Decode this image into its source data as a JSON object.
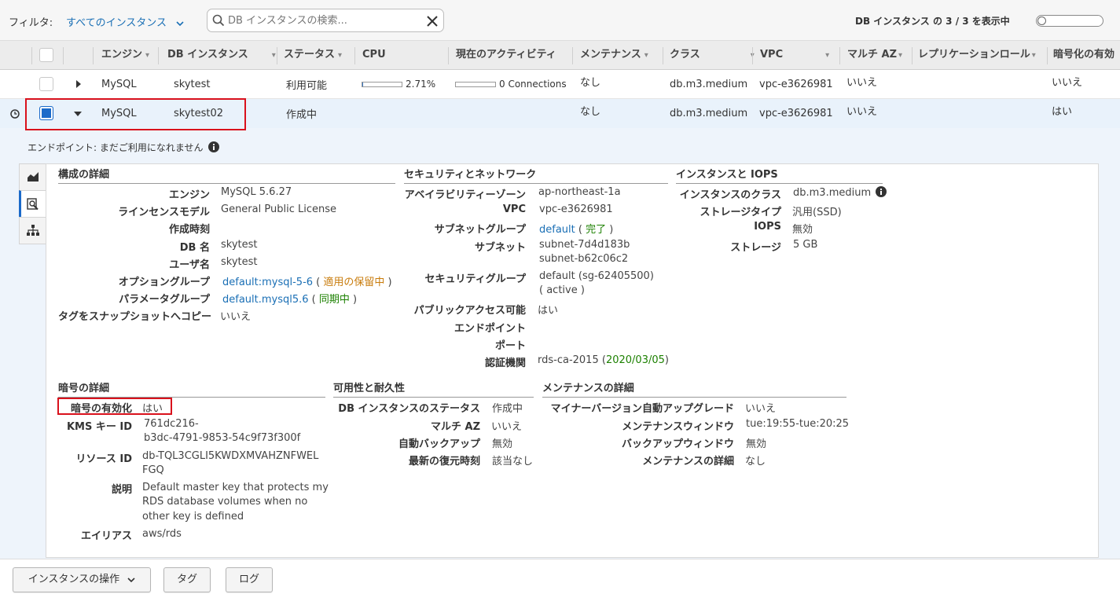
{
  "filter": {
    "label": "フィルタ:",
    "selected": "すべてのインスタンス",
    "search_placeholder": "DB インスタンスの検索...",
    "count_text": "DB インスタンス の 3 / 3 を表示中"
  },
  "table": {
    "headers": {
      "engine": "エンジン",
      "db_instance": "DB インスタンス",
      "status": "ステータス",
      "cpu": "CPU",
      "activity": "現在のアクティビティ",
      "maintenance": "メンテナンス",
      "class": "クラス",
      "vpc": "VPC",
      "multi_az": "マルチ AZ",
      "replication": "レプリケーションロール",
      "encryption": "暗号化の有効"
    },
    "rows": [
      {
        "engine": "MySQL",
        "instance": "skytest",
        "status": "利用可能",
        "cpu_text": "2.71%",
        "cpu_percent": 2.71,
        "activity": "0 Connections",
        "maintenance": "なし",
        "class": "db.m3.medium",
        "vpc": "vpc-e3626981",
        "multi_az": "いいえ",
        "encryption": "いいえ"
      },
      {
        "engine": "MySQL",
        "instance": "skytest02",
        "status": "作成中",
        "maintenance": "なし",
        "class": "db.m3.medium",
        "vpc": "vpc-e3626981",
        "multi_az": "いいえ",
        "encryption": "はい"
      }
    ]
  },
  "detail": {
    "endpoint_note": "エンドポイント: まだご利用になれません",
    "config": {
      "title": "構成の詳細",
      "engine_l": "エンジン",
      "engine_v": "MySQL 5.6.27",
      "license_l": "ラインセンスモデル",
      "license_v": "General Public License",
      "created_l": "作成時刻",
      "dbname_l": "DB 名",
      "dbname_v": "skytest",
      "user_l": "ユーザ名",
      "user_v": "skytest",
      "optgroup_l": "オプショングループ",
      "optgroup_link": "default:mysql-5-6",
      "optgroup_status": "適用の保留中",
      "paramgroup_l": "パラメータグループ",
      "paramgroup_link": "default.mysql5.6",
      "paramgroup_status": "同期中",
      "tagcopy_l": "タグをスナップショットへコピー",
      "tagcopy_v": "いいえ"
    },
    "security": {
      "title": "セキュリティとネットワーク",
      "az_l": "アベイラビリティーゾーン",
      "az_v": "ap-northeast-1a",
      "vpc_l": "VPC",
      "vpc_v": "vpc-e3626981",
      "subnetgroup_l": "サブネットグループ",
      "subnetgroup_link": "default",
      "subnetgroup_status": "完了",
      "subnet_l": "サブネット",
      "subnet_v1": "subnet-7d4d183b",
      "subnet_v2": "subnet-b62c06c2",
      "secgroup_l": "セキュリティグループ",
      "secgroup_v": "default (sg-62405500)",
      "secgroup_state": "( active )",
      "public_l": "パブリックアクセス可能",
      "public_v": "はい",
      "endpoint_l": "エンドポイント",
      "port_l": "ポート",
      "ca_l": "認証機関",
      "ca_v": "rds-ca-2015",
      "ca_date": "2020/03/05"
    },
    "iops": {
      "title": "インスタンスと IOPS",
      "class_l": "インスタンスのクラス",
      "class_v": "db.m3.medium",
      "storage_type_l": "ストレージタイプ",
      "storage_type_v": "汎用(SSD)",
      "iops_l": "IOPS",
      "iops_v": "無効",
      "storage_l": "ストレージ",
      "storage_v": "5 GB"
    },
    "encryption": {
      "title": "暗号の詳細",
      "enabled_l": "暗号の有効化",
      "enabled_v": "はい",
      "kms_l": "KMS キー ID",
      "kms_v1": "761dc216-",
      "kms_v2": "b3dc-4791-9853-54c9f73f300f",
      "resource_l": "リソース ID",
      "resource_v1": "db-TQL3CGLI5KWDXMVAHZNFWEL",
      "resource_v2": "FGQ",
      "desc_l": "説明",
      "desc_v1": "Default master key that protects my",
      "desc_v2": "RDS database volumes when no",
      "desc_v3": "other key is defined",
      "alias_l": "エイリアス",
      "alias_v": "aws/rds"
    },
    "availability": {
      "title": "可用性と耐久性",
      "status_l": "DB インスタンスのステータス",
      "status_v": "作成中",
      "multiaz_l": "マルチ AZ",
      "multiaz_v": "いいえ",
      "backup_l": "自動バックアップ",
      "backup_v": "無効",
      "restore_l": "最新の復元時刻",
      "restore_v": "該当なし"
    },
    "maintenance": {
      "title": "メンテナンスの詳細",
      "minor_l": "マイナーバージョン自動アップグレード",
      "minor_v": "いいえ",
      "window_l": "メンテナンスウィンドウ",
      "window_v": "tue:19:55-tue:20:25",
      "backup_window_l": "バックアップウィンドウ",
      "backup_window_v": "無効",
      "detail_l": "メンテナンスの詳細",
      "detail_v": "なし"
    }
  },
  "footer": {
    "actions": "インスタンスの操作",
    "tags": "タグ",
    "logs": "ログ"
  },
  "colors": {
    "link": "#1a6fb5",
    "ok": "#1d8102",
    "pending": "#c87b0b",
    "bad": "#b51f1f",
    "highlight": "#d9111c"
  }
}
